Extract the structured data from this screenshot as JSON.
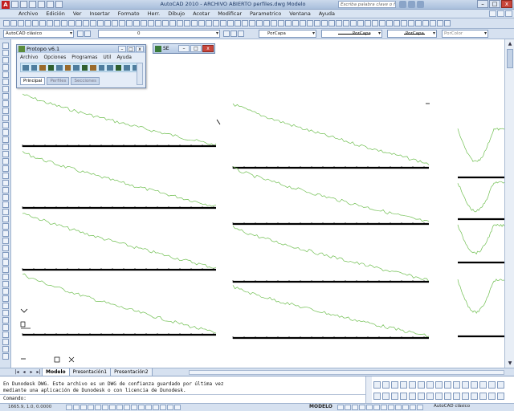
{
  "titlebar": {
    "app_logo": "A",
    "title": "AutoCAD 2010 - ARCHIVO ABIERTO   perfiles.dwg   Modelo",
    "search_placeholder": "Escriba palabra clave o frase",
    "win_min": "–",
    "win_max": "□",
    "win_close": "x"
  },
  "menu": {
    "items": [
      "Archivo",
      "Edición",
      "Ver",
      "Insertar",
      "Formato",
      "Herr.",
      "Dibujo",
      "Acotar",
      "Modificar",
      "Parametrico",
      "Ventana",
      "Ayuda"
    ]
  },
  "toolbar": {
    "workspace": "AutoCAD clásico",
    "layer": "0",
    "color": "PorCapa",
    "linetype": "PorCapa",
    "lineweight": "PorCapa",
    "plotstyle": "PorColor"
  },
  "protopo": {
    "title": "Protopo v6.1",
    "menu": [
      "Archivo",
      "Opciones",
      "Programas",
      "Util",
      "Ayuda"
    ],
    "tabs": [
      "Principal",
      "Perfiles",
      "Secciones"
    ],
    "btn_min": "–",
    "btn_max": "□",
    "btn_close": "x"
  },
  "smallwin": {
    "title": "SE",
    "btn_min": "–",
    "btn_max": "□",
    "btn_close": "x"
  },
  "tabs": {
    "items": [
      "Modelo",
      "Presentación1",
      "Presentación2"
    ],
    "nav": [
      "|◂",
      "◂",
      "▸",
      "▸|"
    ]
  },
  "command": {
    "line1": "En Dunodesk DWG. Este archivo es un DWG de confianza guardado por última vez",
    "line2": "mediante una aplicación de Dunodesk o con licencia de Dunodesk.",
    "line3": "Comando:"
  },
  "status": {
    "coords": "1665.9, 1.0, 0.0000",
    "model": "MODELO",
    "workspace": "AutoCAD clásico"
  },
  "colors": {
    "profile_line": "#6fbf50",
    "titlebar_close": "#c8463b",
    "background": "#c9d6e8"
  }
}
